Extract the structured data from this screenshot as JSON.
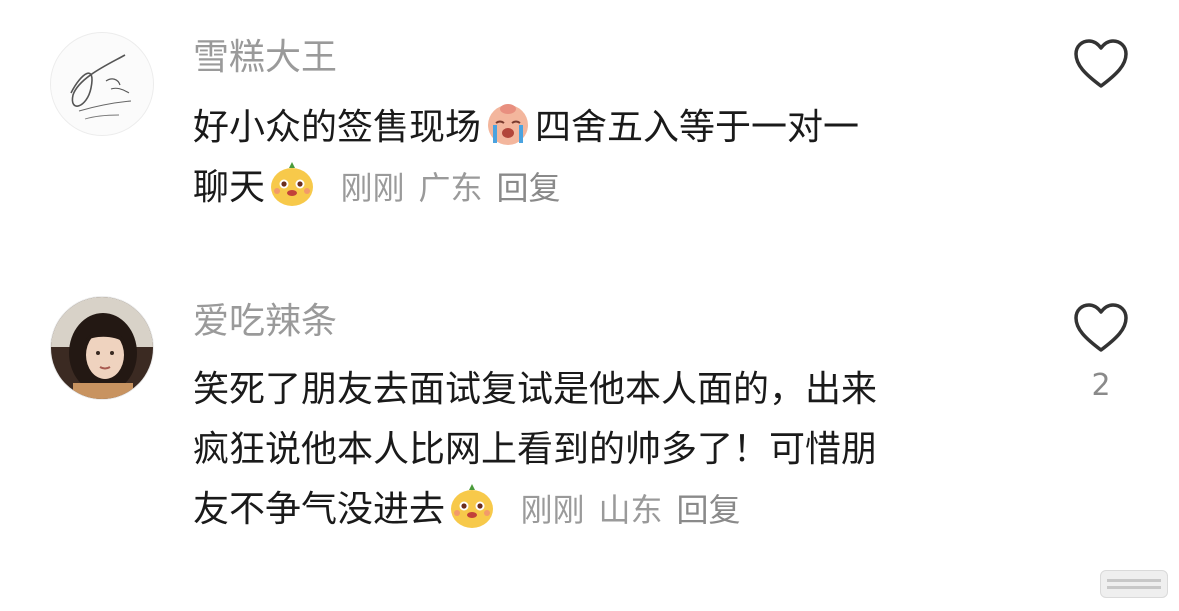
{
  "comments": [
    {
      "username": "雪糕大王",
      "text_line1": "好小众的签售现场",
      "text_line1_after": "四舍五入等于一对一",
      "text_line2": "聊天",
      "time": "刚刚",
      "location": "广东",
      "reply_label": "回复",
      "inline_emoji": "crying-emoji-icon",
      "tail_emoji": "smiling-dog-emoji-icon"
    },
    {
      "username": "爱吃辣条",
      "text_line1": "笑死了朋友去面试复试是他本人面的，出来",
      "text_line2": "疯狂说他本人比网上看到的帅多了！可惜朋",
      "text_line3": "友不争气没进去",
      "time": "刚刚",
      "location": "山东",
      "reply_label": "回复",
      "like_count": "2",
      "tail_emoji": "smiling-dog-emoji-icon"
    }
  ],
  "colors": {
    "username": "#9a9a9a",
    "text": "#1a1a1a",
    "meta": "#9a9a9a",
    "heart": "#333333"
  }
}
